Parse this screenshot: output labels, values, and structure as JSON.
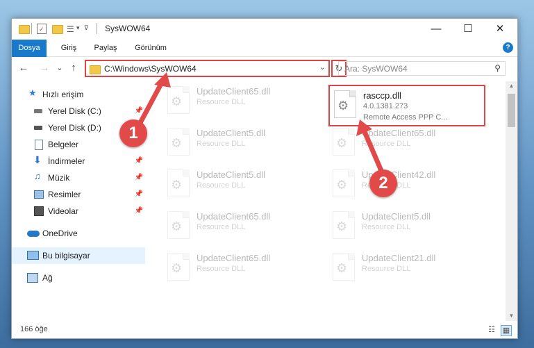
{
  "window": {
    "title": "SysWOW64",
    "controls": {
      "minimize": "—",
      "maximize": "☐",
      "close": "✕"
    }
  },
  "ribbon": {
    "tabs": [
      {
        "label": "Dosya"
      },
      {
        "label": "Giriş"
      },
      {
        "label": "Paylaş"
      },
      {
        "label": "Görünüm"
      }
    ],
    "help": "?"
  },
  "nav": {
    "back": "←",
    "forward": "→",
    "up_menu": "⌄",
    "up": "↑",
    "address": "C:\\Windows\\SysWOW64",
    "refresh": "↻",
    "search_placeholder": "Ara: SysWOW64"
  },
  "sidebar": {
    "items": [
      {
        "label": "Hızlı erişim",
        "icon": "star-icon"
      },
      {
        "label": "Yerel Disk (C:)",
        "icon": "drive-icon",
        "pinned": true
      },
      {
        "label": "Yerel Disk (D:)",
        "icon": "drive-icon",
        "pinned": true
      },
      {
        "label": "Belgeler",
        "icon": "documents-icon",
        "pinned": true
      },
      {
        "label": "İndirmeler",
        "icon": "downloads-icon",
        "pinned": true
      },
      {
        "label": "Müzik",
        "icon": "music-icon",
        "pinned": true
      },
      {
        "label": "Resimler",
        "icon": "pictures-icon",
        "pinned": true
      },
      {
        "label": "Videolar",
        "icon": "videos-icon",
        "pinned": true
      },
      {
        "label": "OneDrive",
        "icon": "cloud-icon"
      },
      {
        "label": "Bu bilgisayar",
        "icon": "computer-icon",
        "selected": true
      },
      {
        "label": "Ağ",
        "icon": "network-icon"
      }
    ]
  },
  "files": {
    "column1": [
      {
        "name": "UpdateClient65.dll",
        "sub": "Resource DLL"
      },
      {
        "name": "UpdateClient5.dll",
        "sub": "Resource DLL"
      },
      {
        "name": "UpdateClient5.dll",
        "sub": "Resource DLL"
      },
      {
        "name": "UpdateClient65.dll",
        "sub": "Resource DLL"
      },
      {
        "name": "UpdateClient65.dll",
        "sub": "Resource DLL"
      }
    ],
    "column2": [
      {
        "name": "rasccp.dll",
        "sub": "4.0.1381.273",
        "sub2": "Remote Access PPP C...",
        "highlight": true
      },
      {
        "name": "UpdateClient65.dll",
        "sub": "Resource DLL"
      },
      {
        "name": "UpdateClient42.dll",
        "sub": "Resource DLL"
      },
      {
        "name": "UpdateClient5.dll",
        "sub": "Resource DLL"
      },
      {
        "name": "UpdateClient21.dll",
        "sub": "Resource DLL"
      }
    ]
  },
  "status": {
    "count": "166 öğe"
  },
  "annotations": {
    "step1": "1",
    "step2": "2",
    "color": "#e24a4a"
  }
}
